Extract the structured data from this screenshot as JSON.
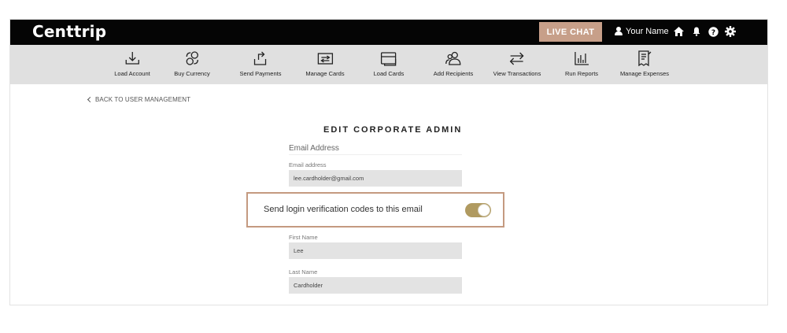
{
  "header": {
    "logo": "Centtrip",
    "live_chat_label": "LIVE CHAT",
    "user_name": "Your Name",
    "icons": [
      "user-icon",
      "home-icon",
      "bell-icon",
      "help-icon",
      "gear-icon"
    ]
  },
  "nav": {
    "items": [
      {
        "label": "Load Account",
        "icon": "download-icon"
      },
      {
        "label": "Buy Currency",
        "icon": "currency-exchange-icon"
      },
      {
        "label": "Send Payments",
        "icon": "upload-arrow-icon"
      },
      {
        "label": "Manage Cards",
        "icon": "card-exchange-icon"
      },
      {
        "label": "Load Cards",
        "icon": "card-icon"
      },
      {
        "label": "Add Recipients",
        "icon": "recipients-icon"
      },
      {
        "label": "View Transactions",
        "icon": "transfer-arrows-icon"
      },
      {
        "label": "Run Reports",
        "icon": "bar-chart-icon"
      },
      {
        "label": "Manage Expenses",
        "icon": "receipt-icon"
      }
    ]
  },
  "page": {
    "back_link": "BACK TO USER MANAGEMENT",
    "title": "EDIT CORPORATE ADMIN",
    "section_label": "Email Address"
  },
  "form": {
    "email": {
      "label": "Email address",
      "value": "lee.cardholder@gmail.com"
    },
    "verification": {
      "label": "Send login verification codes to this email",
      "enabled": true
    },
    "first_name": {
      "label": "First Name",
      "value": "Lee"
    },
    "last_name": {
      "label": "Last Name",
      "value": "Cardholder"
    }
  },
  "colors": {
    "header_bg": "#050505",
    "nav_bg": "#e0e0e0",
    "live_chat": "#c79f89",
    "highlight_border": "#c49a80",
    "toggle_on": "#b09a60"
  }
}
